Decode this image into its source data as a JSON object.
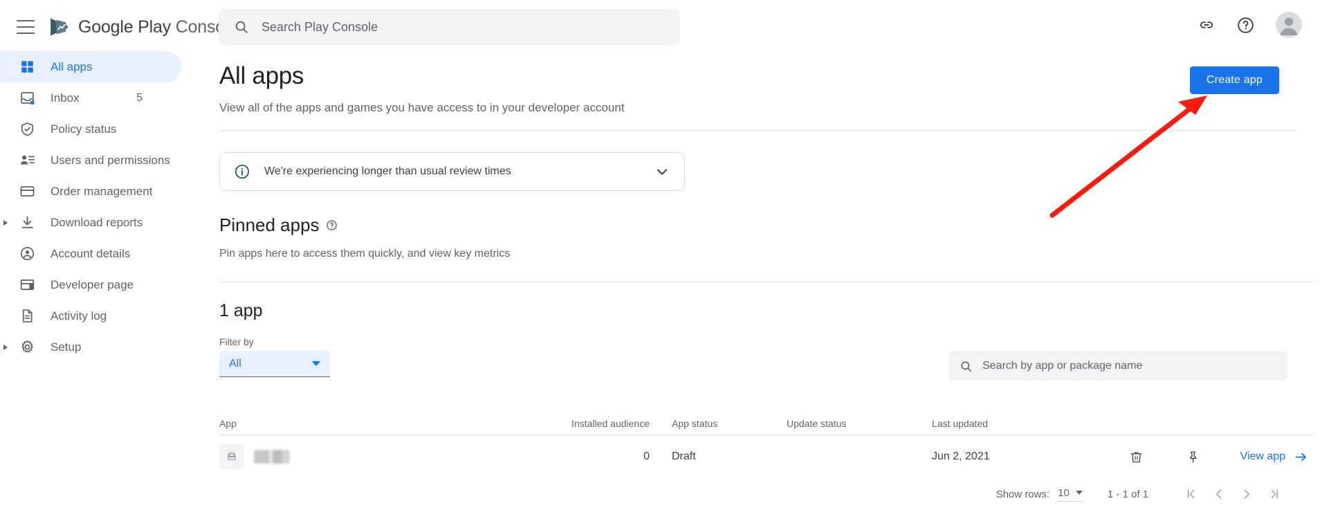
{
  "header": {
    "menu_icon": "hamburger-menu-icon",
    "brand_google_play": "Google Play",
    "brand_console": "Console",
    "logo_icon": "google-play-console-logo-icon",
    "search": {
      "icon": "search-icon",
      "placeholder": "Search Play Console",
      "value": ""
    },
    "link_icon": "link-icon",
    "help_icon": "help-circle-icon",
    "avatar_icon": "user-avatar-icon"
  },
  "sidebar": {
    "items": [
      {
        "label": "All apps",
        "icon": "grid-apps-icon",
        "active": true,
        "badge": "",
        "expandable": false
      },
      {
        "label": "Inbox",
        "icon": "inbox-icon",
        "active": false,
        "badge": "5",
        "expandable": false
      },
      {
        "label": "Policy status",
        "icon": "shield-check-icon",
        "active": false,
        "badge": "",
        "expandable": false
      },
      {
        "label": "Users and permissions",
        "icon": "users-permissions-icon",
        "active": false,
        "badge": "",
        "expandable": false
      },
      {
        "label": "Order management",
        "icon": "credit-card-icon",
        "active": false,
        "badge": "",
        "expandable": false
      },
      {
        "label": "Download reports",
        "icon": "download-icon",
        "active": false,
        "badge": "",
        "expandable": true
      },
      {
        "label": "Account details",
        "icon": "account-circle-icon",
        "active": false,
        "badge": "",
        "expandable": false
      },
      {
        "label": "Developer page",
        "icon": "developer-page-icon",
        "active": false,
        "badge": "",
        "expandable": false
      },
      {
        "label": "Activity log",
        "icon": "document-icon",
        "active": false,
        "badge": "",
        "expandable": false
      },
      {
        "label": "Setup",
        "icon": "gear-icon",
        "active": false,
        "badge": "",
        "expandable": true
      }
    ]
  },
  "main": {
    "title": "All apps",
    "subtitle": "View all of the apps and games you have access to in your developer account",
    "create_app_label": "Create app",
    "banner": {
      "icon": "info-circle-icon",
      "text": "We're experiencing longer than usual review times",
      "chevron_icon": "chevron-down-icon"
    },
    "pinned": {
      "title": "Pinned apps",
      "help_icon": "help-circle-small-icon",
      "subtitle": "Pin apps here to access them quickly, and view key metrics"
    },
    "app_count_label": "1 app",
    "filter": {
      "label": "Filter by",
      "value": "All",
      "caret_icon": "chevron-down-icon"
    },
    "app_search": {
      "icon": "search-icon",
      "placeholder": "Search by app or package name",
      "value": ""
    },
    "table": {
      "columns": [
        "App",
        "Installed audience",
        "App status",
        "Update status",
        "Last updated"
      ],
      "rows": [
        {
          "app_icon": "android-app-icon",
          "app_name": "",
          "app_name_redacted": true,
          "installed_audience": "0",
          "app_status": "Draft",
          "update_status": "",
          "last_updated": "Jun 2, 2021",
          "delete_icon": "trash-icon",
          "pin_icon": "pin-icon",
          "view_app_label": "View app",
          "view_app_arrow_icon": "arrow-right-icon"
        }
      ]
    },
    "pagination": {
      "show_rows_label": "Show rows:",
      "rows_per_page": "10",
      "range_label": "1 - 1 of 1",
      "first_icon": "first-page-icon",
      "prev_icon": "chevron-left-icon",
      "next_icon": "chevron-right-icon",
      "last_icon": "last-page-icon"
    }
  },
  "annotation": {
    "arrow_color": "#f91c0c",
    "arrow_icon": "red-pointer-arrow",
    "points_to": "Create app"
  },
  "colors": {
    "accent_blue": "#1a73e8",
    "active_nav_bg": "#e8f0fe",
    "text_primary": "#202124",
    "text_secondary": "#5f6368",
    "field_bg": "#f1f3f4",
    "border": "#e0e0e0",
    "annotation_red": "#f91c0c"
  }
}
